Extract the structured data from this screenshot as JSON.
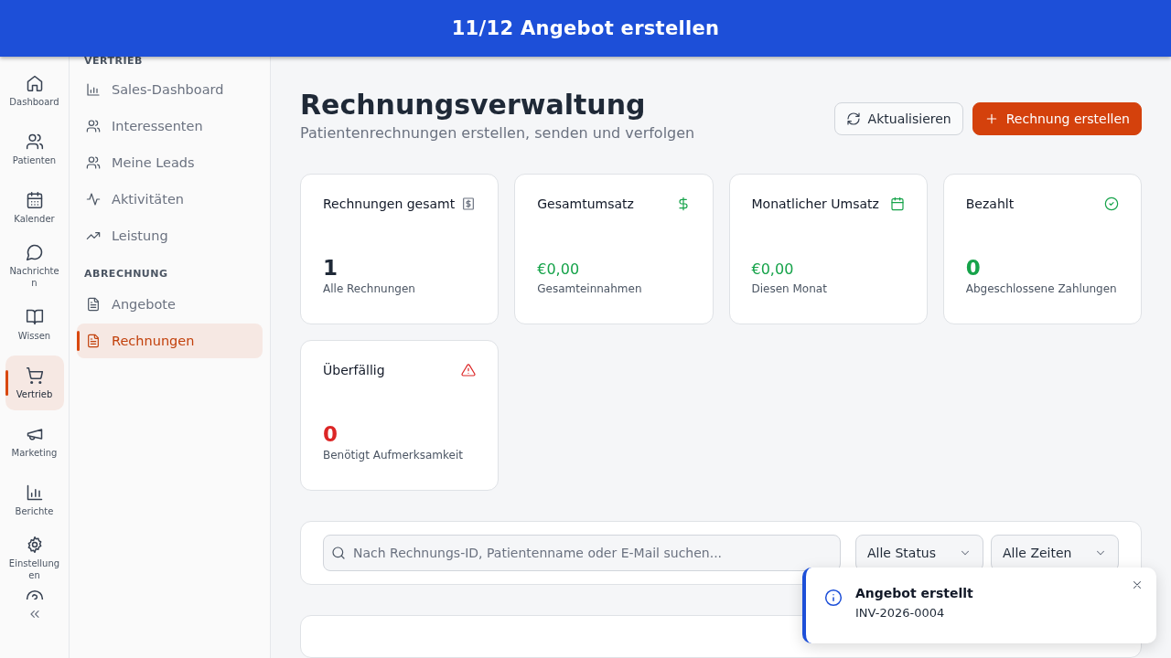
{
  "banner": {
    "title": "11/12 Angebot erstellen"
  },
  "rail": {
    "items": [
      {
        "label": "Dashboard",
        "selected": false
      },
      {
        "label": "Patienten",
        "selected": false
      },
      {
        "label": "Kalender",
        "selected": false
      },
      {
        "label": "Nachrichten",
        "selected": false
      },
      {
        "label": "Wissen",
        "selected": false
      },
      {
        "label": "Vertrieb",
        "selected": true
      },
      {
        "label": "Marketing",
        "selected": false
      },
      {
        "label": "Berichte",
        "selected": false
      },
      {
        "label": "Einstellungen",
        "selected": false
      }
    ]
  },
  "subnav": {
    "sections": [
      {
        "title": "VERTRIEB",
        "items": [
          {
            "label": "Sales-Dashboard",
            "selected": false
          },
          {
            "label": "Interessenten",
            "selected": false
          },
          {
            "label": "Meine Leads",
            "selected": false
          },
          {
            "label": "Aktivitäten",
            "selected": false
          },
          {
            "label": "Leistung",
            "selected": false
          }
        ]
      },
      {
        "title": "ABRECHNUNG",
        "items": [
          {
            "label": "Angebote",
            "selected": false
          },
          {
            "label": "Rechnungen",
            "selected": true
          }
        ]
      }
    ]
  },
  "header": {
    "title": "Rechnungsverwaltung",
    "subtitle": "Patientenrechnungen erstellen, senden und verfolgen",
    "buttons": [
      {
        "label": "Aktualisieren",
        "kind": "secondary"
      },
      {
        "label": "Rechnung erstellen",
        "kind": "primary"
      }
    ]
  },
  "stats": [
    {
      "title": "Rechnungen gesamt",
      "value": "1",
      "caption": "Alle Rechnungen",
      "color": "#1f2937"
    },
    {
      "title": "Gesamtumsatz",
      "value": "€0,00",
      "caption": "Gesamteinnahmen",
      "color": "#16a34a"
    },
    {
      "title": "Monatlicher Umsatz",
      "value": "€0,00",
      "caption": "Diesen Monat",
      "color": "#16a34a"
    },
    {
      "title": "Bezahlt",
      "value": "0",
      "caption": "Abgeschlossene Zahlungen",
      "color": "#16a34a"
    },
    {
      "title": "Überfällig",
      "value": "0",
      "caption": "Benötigt Aufmerksamkeit",
      "color": "#dc2626"
    }
  ],
  "filters": {
    "search": {
      "placeholder": "Nach Rechnungs-ID, Patientenname oder E-Mail suchen..."
    },
    "dropdowns": [
      "Alle Status",
      "Alle Zeiten"
    ]
  },
  "toast": {
    "title": "Angebot erstellt",
    "message": "INV-2026-0004"
  }
}
